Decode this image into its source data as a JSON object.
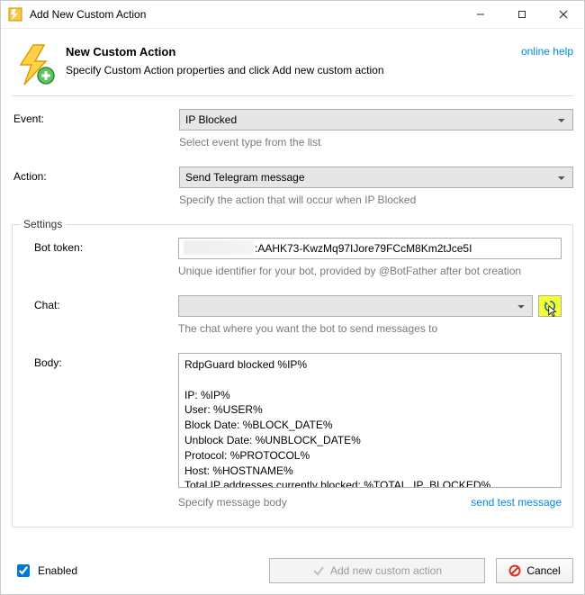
{
  "window": {
    "title": "Add New Custom Action"
  },
  "header": {
    "heading": "New Custom Action",
    "subheading": "Specify Custom Action properties and click Add new custom action",
    "online_help": "online help"
  },
  "event": {
    "label": "Event:",
    "value": "IP Blocked",
    "help": "Select event type from the list"
  },
  "action": {
    "label": "Action:",
    "value": "Send Telegram message",
    "help": "Specify the action that will occur when IP Blocked"
  },
  "settings": {
    "legend": "Settings",
    "bot_token": {
      "label": "Bot token:",
      "value": ":AAHK73-KwzMq97IJore79FCcM8Km2tJce5I",
      "help": "Unique identifier for your bot, provided by @BotFather after bot creation"
    },
    "chat": {
      "label": "Chat:",
      "value": "",
      "help": "The chat where you want the bot to send messages to"
    },
    "body": {
      "label": "Body:",
      "value": "RdpGuard blocked %IP%\n\nIP: %IP%\nUser: %USER%\nBlock Date: %BLOCK_DATE%\nUnblock Date: %UNBLOCK_DATE%\nProtocol: %PROTOCOL%\nHost: %HOSTNAME%\nTotal IP addresses currently blocked: %TOTAL_IP_BLOCKED%",
      "help": "Specify message body",
      "test_link": "send test message"
    }
  },
  "footer": {
    "enabled_label": "Enabled",
    "enabled_checked": true,
    "add_button": "Add new custom action",
    "cancel_button": "Cancel"
  }
}
